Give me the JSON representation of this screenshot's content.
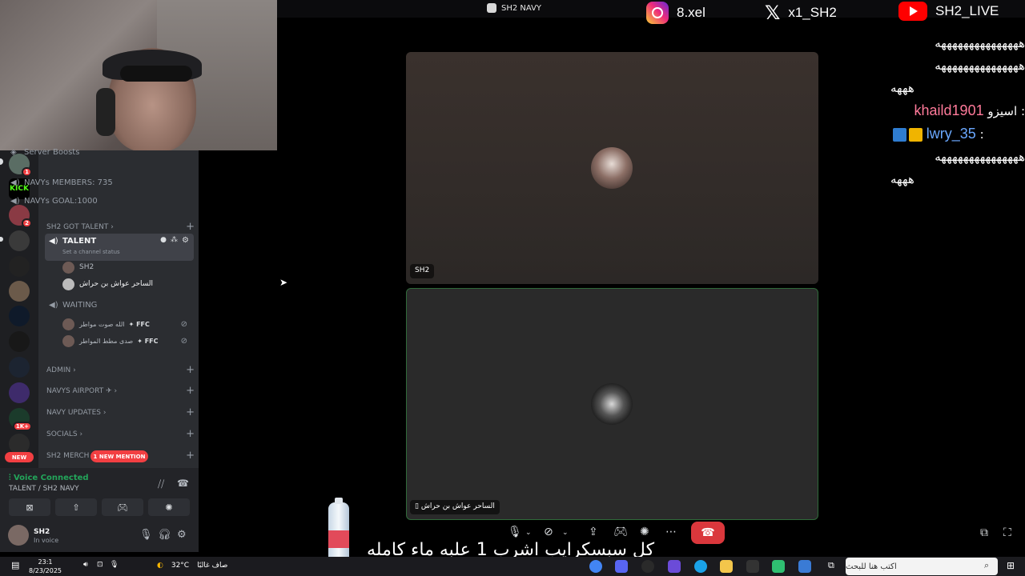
{
  "window": {
    "title": "SH2 NAVY"
  },
  "socials": {
    "instagram": "8.xel",
    "x": "x1_SH2",
    "youtube": "SH2_LIVE"
  },
  "server_rail": {
    "kick_label": "KICK",
    "badges": [
      "1",
      "2",
      "1K+"
    ],
    "new_label": "NEW"
  },
  "channels": {
    "server_boosts": "Server Boosts",
    "members_count": "NAVYs MEMBERS: 735",
    "goal": "NAVYs GOAL:1000",
    "cat_got_talent": "SH2 GOT TALENT",
    "talent": "TALENT",
    "talent_status": "Set a channel status",
    "talent_members": [
      "SH2",
      "الساحر عواش بن حراش"
    ],
    "waiting": "WAITING",
    "waiting_members": [
      "الله صوت مواطر",
      "صدى مطط المواطر"
    ],
    "ffc_tag": "FFC",
    "cat_admin": "ADMIN",
    "cat_airport": "NAVYS AIRPORT",
    "cat_updates": "NAVY UPDATES",
    "cat_socials": "SOCIALS",
    "cat_merch": "SH2 MERCH",
    "new_mention": "1 NEW MENTION"
  },
  "voice_panel": {
    "status": "Voice Connected",
    "channel": "TALENT / SH2 NAVY",
    "username": "SH2",
    "user_status": "In voice"
  },
  "stage": {
    "tile1_name": "SH2",
    "tile2_name": "الساحر عواش بن حراش"
  },
  "subtitle": "كل سبسكرايب اشرب 1 علبه ماء كامله",
  "chat": {
    "line1": "هههههههههههههههه",
    "line2": "هههههههههههههههه",
    "line3": "هههه",
    "user1_prefix": "اسيزو :",
    "user1": "khaild1901",
    "user2": "lwry_35",
    "user2_sep": ":",
    "line4": "هههههههههههههههه",
    "line5": "هههه"
  },
  "taskbar": {
    "time": "23:1",
    "date": "8/23/2025",
    "weather_temp": "32°C",
    "weather_desc": "صاف غالبًا",
    "search_placeholder": "اكتب هنا للبحث"
  },
  "colors": {
    "discord_bg": "#2b2d31",
    "voice_green": "#23a55a",
    "danger": "#da373c",
    "mention_red": "#f23f42"
  }
}
